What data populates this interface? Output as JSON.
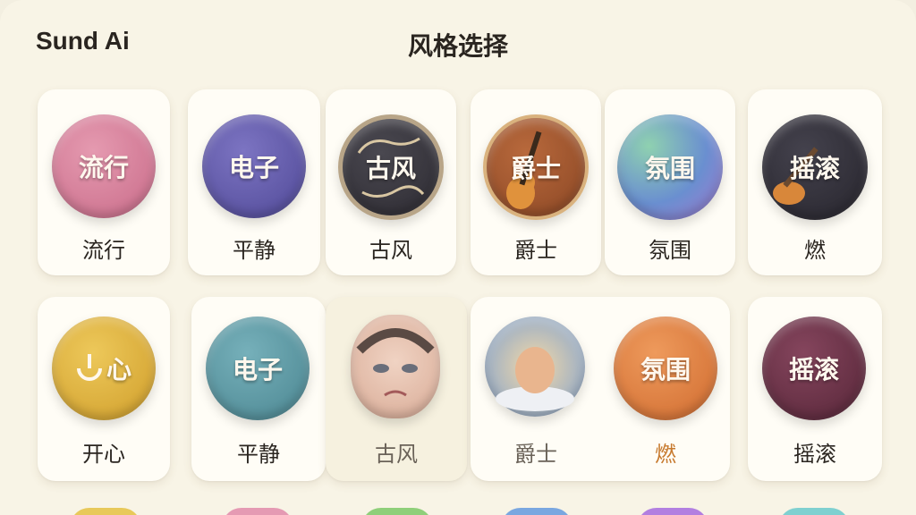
{
  "header": {
    "app_name": "Sund Ai",
    "title": "风格选择"
  },
  "row1": [
    {
      "badge_text": "流行",
      "label": "流行",
      "color": "#d47a97"
    },
    {
      "badge_text": "电子",
      "label": "平静",
      "color": "#5f58a8"
    },
    {
      "badge_text": "古风",
      "label": "古风",
      "color": "#3c3a3f"
    },
    {
      "badge_text": "爵士",
      "label": "爵士",
      "color": "#a1562e"
    },
    {
      "badge_text": "氛围",
      "label": "氛围",
      "color": "#6a8fd0"
    },
    {
      "badge_text": "摇滚",
      "label": "燃",
      "color": "#34323d"
    }
  ],
  "row2": [
    {
      "badge_text": "心",
      "label": "开心",
      "color": "#e0b53c"
    },
    {
      "badge_text": "电子",
      "label": "平静",
      "color": "#5f9ba6"
    },
    {
      "badge_text": "",
      "label": "古风",
      "color": "#d9b8a6",
      "icon": "sad-face-icon"
    },
    {
      "badge_text": "",
      "label": "爵士",
      "color": "#c8c0b0",
      "icon": "sunburst-cloud-icon"
    },
    {
      "badge_text": "氛围",
      "label": "燃",
      "color": "#e07a3b"
    },
    {
      "badge_text": "摇滚",
      "label": "摇滚",
      "color": "#6a3448"
    }
  ],
  "row3_colors": [
    "#e8c95a",
    "#e59ab3",
    "#8fcf7a",
    "#7aa7e0",
    "#b27fe0",
    "#7fd0d0"
  ]
}
